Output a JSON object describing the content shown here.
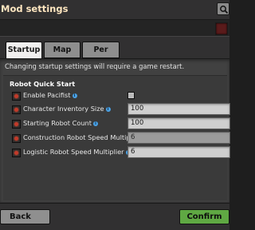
{
  "window": {
    "title": "Mod settings"
  },
  "toolbar": {
    "search_icon": "search-icon",
    "indicator_color": "#5a1b1b"
  },
  "tabs": [
    {
      "label": "Startup",
      "active": true
    },
    {
      "label": "Map",
      "active": false
    },
    {
      "label": "Per player",
      "active": false
    }
  ],
  "notice": "Changing startup settings will require a game restart.",
  "section": {
    "title": "Robot Quick Start",
    "settings": [
      {
        "label": "Enable Pacifist",
        "type": "checkbox",
        "checked": false,
        "has_info": true
      },
      {
        "label": "Character Inventory Size",
        "type": "number",
        "value": "100",
        "has_info": true,
        "disabled": false
      },
      {
        "label": "Starting Robot Count",
        "type": "number",
        "value": "100",
        "has_info": true,
        "disabled": false
      },
      {
        "label": "Construction Robot Speed Multiplier",
        "type": "number",
        "value": "6",
        "has_info": true,
        "disabled": true
      },
      {
        "label": "Logistic Robot Speed Multiplier",
        "type": "number",
        "value": "6",
        "has_info": true,
        "disabled": false
      }
    ]
  },
  "footer": {
    "back_label": "Back",
    "confirm_label": "Confirm"
  },
  "colors": {
    "confirm_green": "#5fa843",
    "active_tab": "#f1efef",
    "title_text": "#ffe6c0",
    "info_blue": "#4aa2e6"
  }
}
